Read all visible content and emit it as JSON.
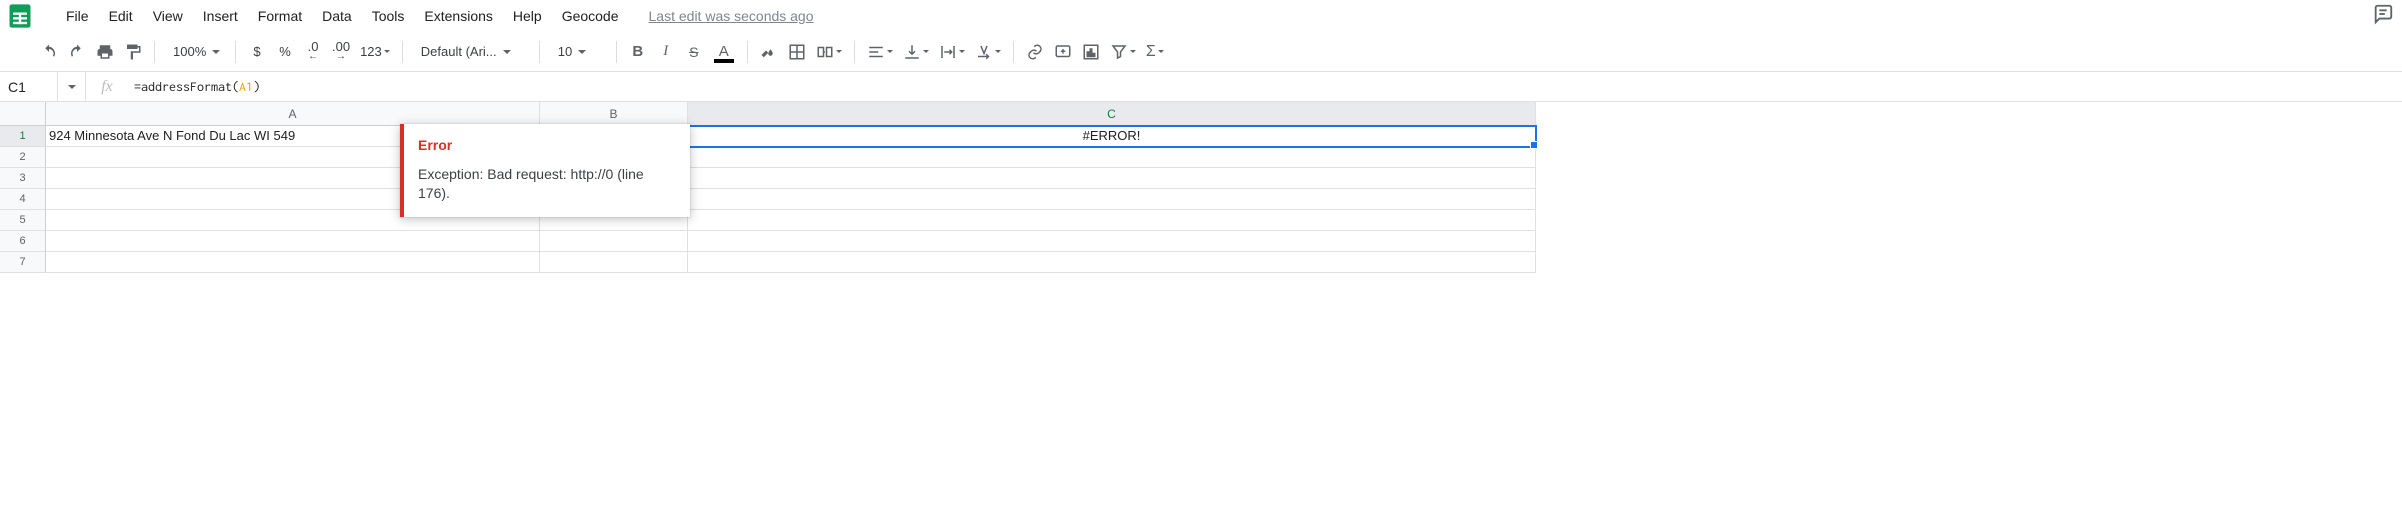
{
  "menu": {
    "items": [
      "File",
      "Edit",
      "View",
      "Insert",
      "Format",
      "Data",
      "Tools",
      "Extensions",
      "Help",
      "Geocode"
    ],
    "last_edit": "Last edit was seconds ago"
  },
  "toolbar": {
    "zoom": "100%",
    "currency": "$",
    "percent": "%",
    "dec_dec": ".0",
    "inc_dec": ".00",
    "more_formats": "123",
    "font": "Default (Ari...",
    "font_size": "10"
  },
  "namebox": {
    "ref": "C1"
  },
  "formula": {
    "prefix": "=",
    "fn": "addressFormat",
    "open": "(",
    "arg": "A1",
    "close": ")"
  },
  "columns": [
    "A",
    "B",
    "C"
  ],
  "cells": {
    "A1": "924 Minnesota Ave N Fond Du Lac WI 549",
    "C1": "#ERROR!"
  },
  "error_tip": {
    "title": "Error",
    "message": "Exception: Bad request: http://0 (line 176)."
  },
  "row_count": 7
}
